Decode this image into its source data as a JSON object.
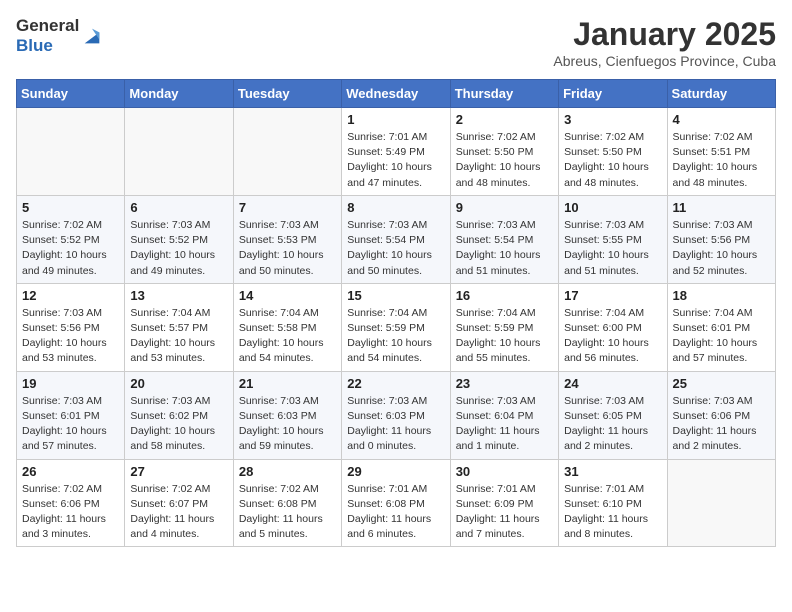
{
  "logo": {
    "general": "General",
    "blue": "Blue"
  },
  "title": "January 2025",
  "location": "Abreus, Cienfuegos Province, Cuba",
  "days_of_week": [
    "Sunday",
    "Monday",
    "Tuesday",
    "Wednesday",
    "Thursday",
    "Friday",
    "Saturday"
  ],
  "weeks": [
    [
      {
        "day": "",
        "info": ""
      },
      {
        "day": "",
        "info": ""
      },
      {
        "day": "",
        "info": ""
      },
      {
        "day": "1",
        "info": "Sunrise: 7:01 AM\nSunset: 5:49 PM\nDaylight: 10 hours\nand 47 minutes."
      },
      {
        "day": "2",
        "info": "Sunrise: 7:02 AM\nSunset: 5:50 PM\nDaylight: 10 hours\nand 48 minutes."
      },
      {
        "day": "3",
        "info": "Sunrise: 7:02 AM\nSunset: 5:50 PM\nDaylight: 10 hours\nand 48 minutes."
      },
      {
        "day": "4",
        "info": "Sunrise: 7:02 AM\nSunset: 5:51 PM\nDaylight: 10 hours\nand 48 minutes."
      }
    ],
    [
      {
        "day": "5",
        "info": "Sunrise: 7:02 AM\nSunset: 5:52 PM\nDaylight: 10 hours\nand 49 minutes."
      },
      {
        "day": "6",
        "info": "Sunrise: 7:03 AM\nSunset: 5:52 PM\nDaylight: 10 hours\nand 49 minutes."
      },
      {
        "day": "7",
        "info": "Sunrise: 7:03 AM\nSunset: 5:53 PM\nDaylight: 10 hours\nand 50 minutes."
      },
      {
        "day": "8",
        "info": "Sunrise: 7:03 AM\nSunset: 5:54 PM\nDaylight: 10 hours\nand 50 minutes."
      },
      {
        "day": "9",
        "info": "Sunrise: 7:03 AM\nSunset: 5:54 PM\nDaylight: 10 hours\nand 51 minutes."
      },
      {
        "day": "10",
        "info": "Sunrise: 7:03 AM\nSunset: 5:55 PM\nDaylight: 10 hours\nand 51 minutes."
      },
      {
        "day": "11",
        "info": "Sunrise: 7:03 AM\nSunset: 5:56 PM\nDaylight: 10 hours\nand 52 minutes."
      }
    ],
    [
      {
        "day": "12",
        "info": "Sunrise: 7:03 AM\nSunset: 5:56 PM\nDaylight: 10 hours\nand 53 minutes."
      },
      {
        "day": "13",
        "info": "Sunrise: 7:04 AM\nSunset: 5:57 PM\nDaylight: 10 hours\nand 53 minutes."
      },
      {
        "day": "14",
        "info": "Sunrise: 7:04 AM\nSunset: 5:58 PM\nDaylight: 10 hours\nand 54 minutes."
      },
      {
        "day": "15",
        "info": "Sunrise: 7:04 AM\nSunset: 5:59 PM\nDaylight: 10 hours\nand 54 minutes."
      },
      {
        "day": "16",
        "info": "Sunrise: 7:04 AM\nSunset: 5:59 PM\nDaylight: 10 hours\nand 55 minutes."
      },
      {
        "day": "17",
        "info": "Sunrise: 7:04 AM\nSunset: 6:00 PM\nDaylight: 10 hours\nand 56 minutes."
      },
      {
        "day": "18",
        "info": "Sunrise: 7:04 AM\nSunset: 6:01 PM\nDaylight: 10 hours\nand 57 minutes."
      }
    ],
    [
      {
        "day": "19",
        "info": "Sunrise: 7:03 AM\nSunset: 6:01 PM\nDaylight: 10 hours\nand 57 minutes."
      },
      {
        "day": "20",
        "info": "Sunrise: 7:03 AM\nSunset: 6:02 PM\nDaylight: 10 hours\nand 58 minutes."
      },
      {
        "day": "21",
        "info": "Sunrise: 7:03 AM\nSunset: 6:03 PM\nDaylight: 10 hours\nand 59 minutes."
      },
      {
        "day": "22",
        "info": "Sunrise: 7:03 AM\nSunset: 6:03 PM\nDaylight: 11 hours\nand 0 minutes."
      },
      {
        "day": "23",
        "info": "Sunrise: 7:03 AM\nSunset: 6:04 PM\nDaylight: 11 hours\nand 1 minute."
      },
      {
        "day": "24",
        "info": "Sunrise: 7:03 AM\nSunset: 6:05 PM\nDaylight: 11 hours\nand 2 minutes."
      },
      {
        "day": "25",
        "info": "Sunrise: 7:03 AM\nSunset: 6:06 PM\nDaylight: 11 hours\nand 2 minutes."
      }
    ],
    [
      {
        "day": "26",
        "info": "Sunrise: 7:02 AM\nSunset: 6:06 PM\nDaylight: 11 hours\nand 3 minutes."
      },
      {
        "day": "27",
        "info": "Sunrise: 7:02 AM\nSunset: 6:07 PM\nDaylight: 11 hours\nand 4 minutes."
      },
      {
        "day": "28",
        "info": "Sunrise: 7:02 AM\nSunset: 6:08 PM\nDaylight: 11 hours\nand 5 minutes."
      },
      {
        "day": "29",
        "info": "Sunrise: 7:01 AM\nSunset: 6:08 PM\nDaylight: 11 hours\nand 6 minutes."
      },
      {
        "day": "30",
        "info": "Sunrise: 7:01 AM\nSunset: 6:09 PM\nDaylight: 11 hours\nand 7 minutes."
      },
      {
        "day": "31",
        "info": "Sunrise: 7:01 AM\nSunset: 6:10 PM\nDaylight: 11 hours\nand 8 minutes."
      },
      {
        "day": "",
        "info": ""
      }
    ]
  ]
}
